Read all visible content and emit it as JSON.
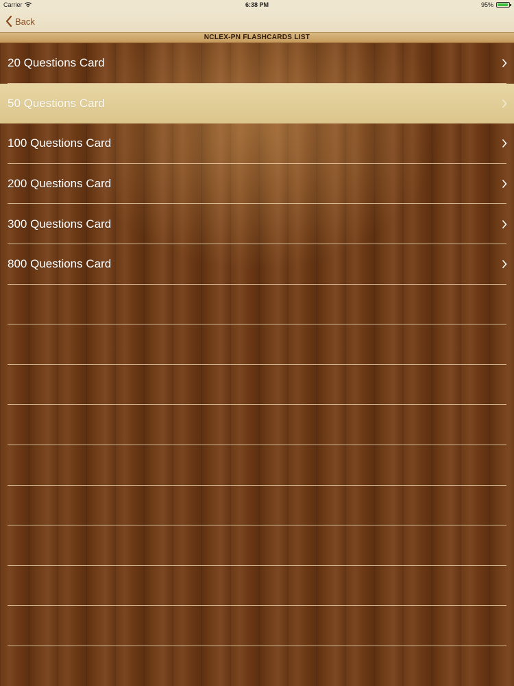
{
  "status_bar": {
    "carrier": "Carrier",
    "time": "6:38 PM",
    "battery": "95%",
    "battery_level": 0.95,
    "wifi_icon": "wifi-icon",
    "battery_icon": "battery-icon"
  },
  "nav": {
    "back_label": "Back",
    "back_icon": "chevron-left-icon"
  },
  "title": "NCLEX-PN FLASHCARDS LIST",
  "list": {
    "items": [
      {
        "label": "20 Questions Card",
        "selected": false
      },
      {
        "label": "50 Questions Card",
        "selected": true
      },
      {
        "label": "100 Questions Card",
        "selected": false
      },
      {
        "label": "200 Questions Card",
        "selected": false
      },
      {
        "label": "300 Questions Card",
        "selected": false
      },
      {
        "label": "800 Questions Card",
        "selected": false
      }
    ],
    "empty_rows": 9
  },
  "colors": {
    "accent": "#8a4a1c",
    "selected_row": "#e2cf98",
    "wood": "#6b3a16"
  }
}
